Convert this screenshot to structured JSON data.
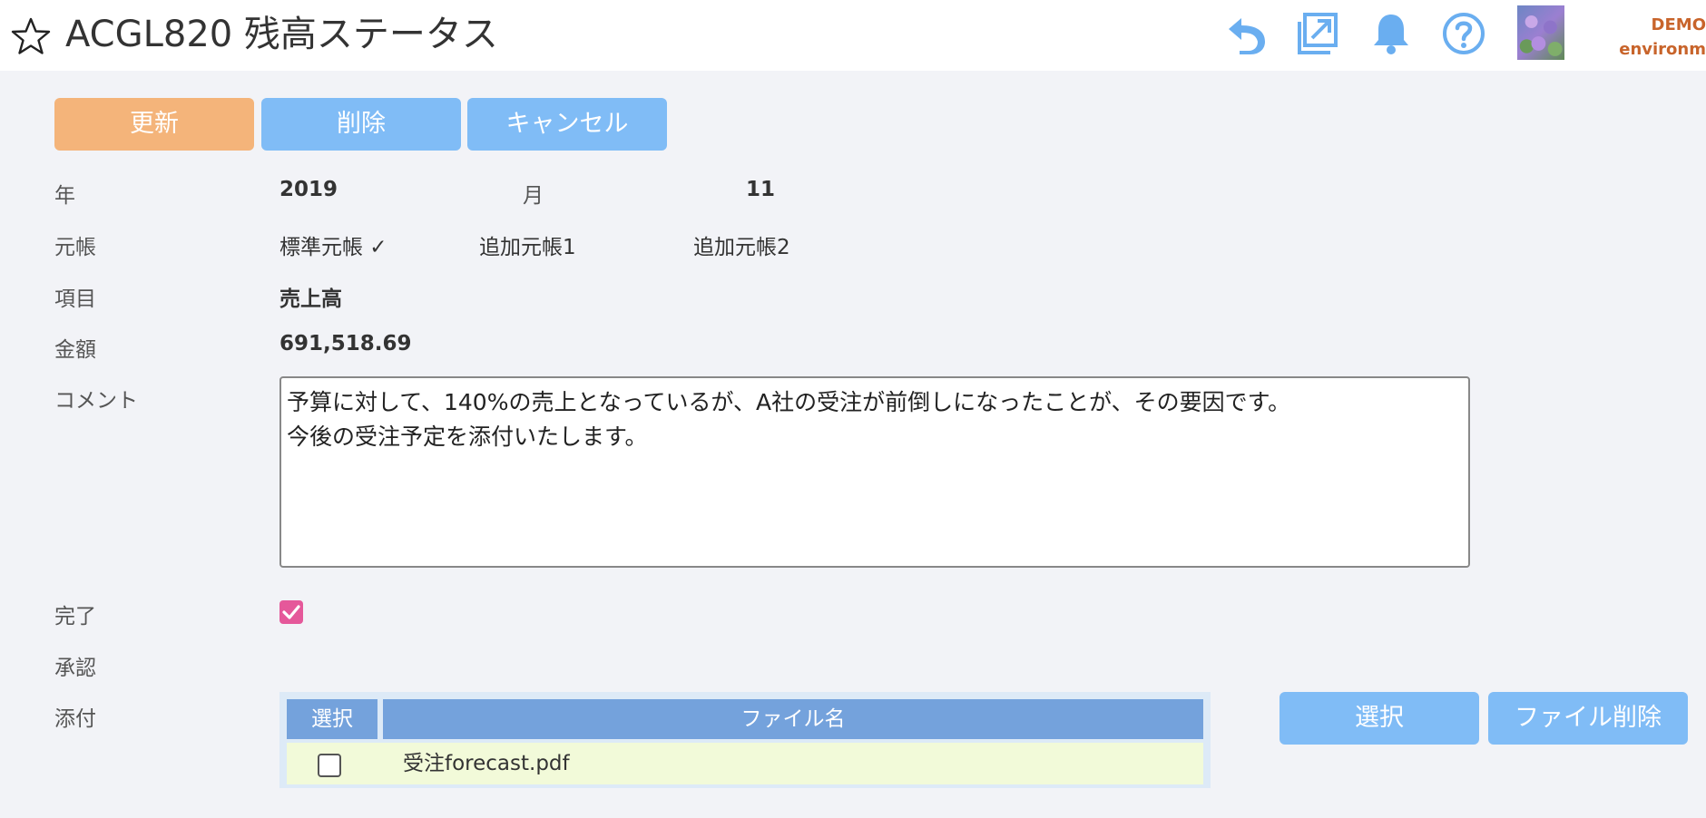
{
  "header": {
    "title": "ACGL820 残高ステータス",
    "env_line1": "DEMO",
    "env_line2": "environm"
  },
  "toolbar": {
    "update_label": "更新",
    "delete_label": "削除",
    "cancel_label": "キャンセル"
  },
  "form": {
    "year_label": "年",
    "year_value": "2019",
    "month_label": "月",
    "month_value": "11",
    "ledger_label": "元帳",
    "ledgers": [
      "標準元帳 ✓",
      "追加元帳1",
      "追加元帳2"
    ],
    "item_label": "項目",
    "item_value": "売上高",
    "amount_label": "金額",
    "amount_value": "691,518.69",
    "comment_label": "コメント",
    "comment_value": "予算に対して、140%の売上となっているが、A社の受注が前倒しになったことが、その要因です。\n今後の受注予定を添付いたします。",
    "done_label": "完了",
    "done_checked": true,
    "approval_label": "承認",
    "attach_label": "添付"
  },
  "attachments": {
    "columns": [
      "選択",
      "ファイル名"
    ],
    "rows": [
      {
        "file": "受注forecast.pdf",
        "selected": false
      }
    ],
    "select_button": "選択",
    "delete_file_button": "ファイル削除"
  },
  "colors": {
    "update_button": "#f4b47a",
    "action_button": "#80bcf6",
    "table_header": "#74a2dc",
    "row_background": "#f2fad9",
    "checkbox_checked": "#e5589a",
    "environment_text": "#c8642b",
    "icon_blue": "#6aaef0"
  }
}
